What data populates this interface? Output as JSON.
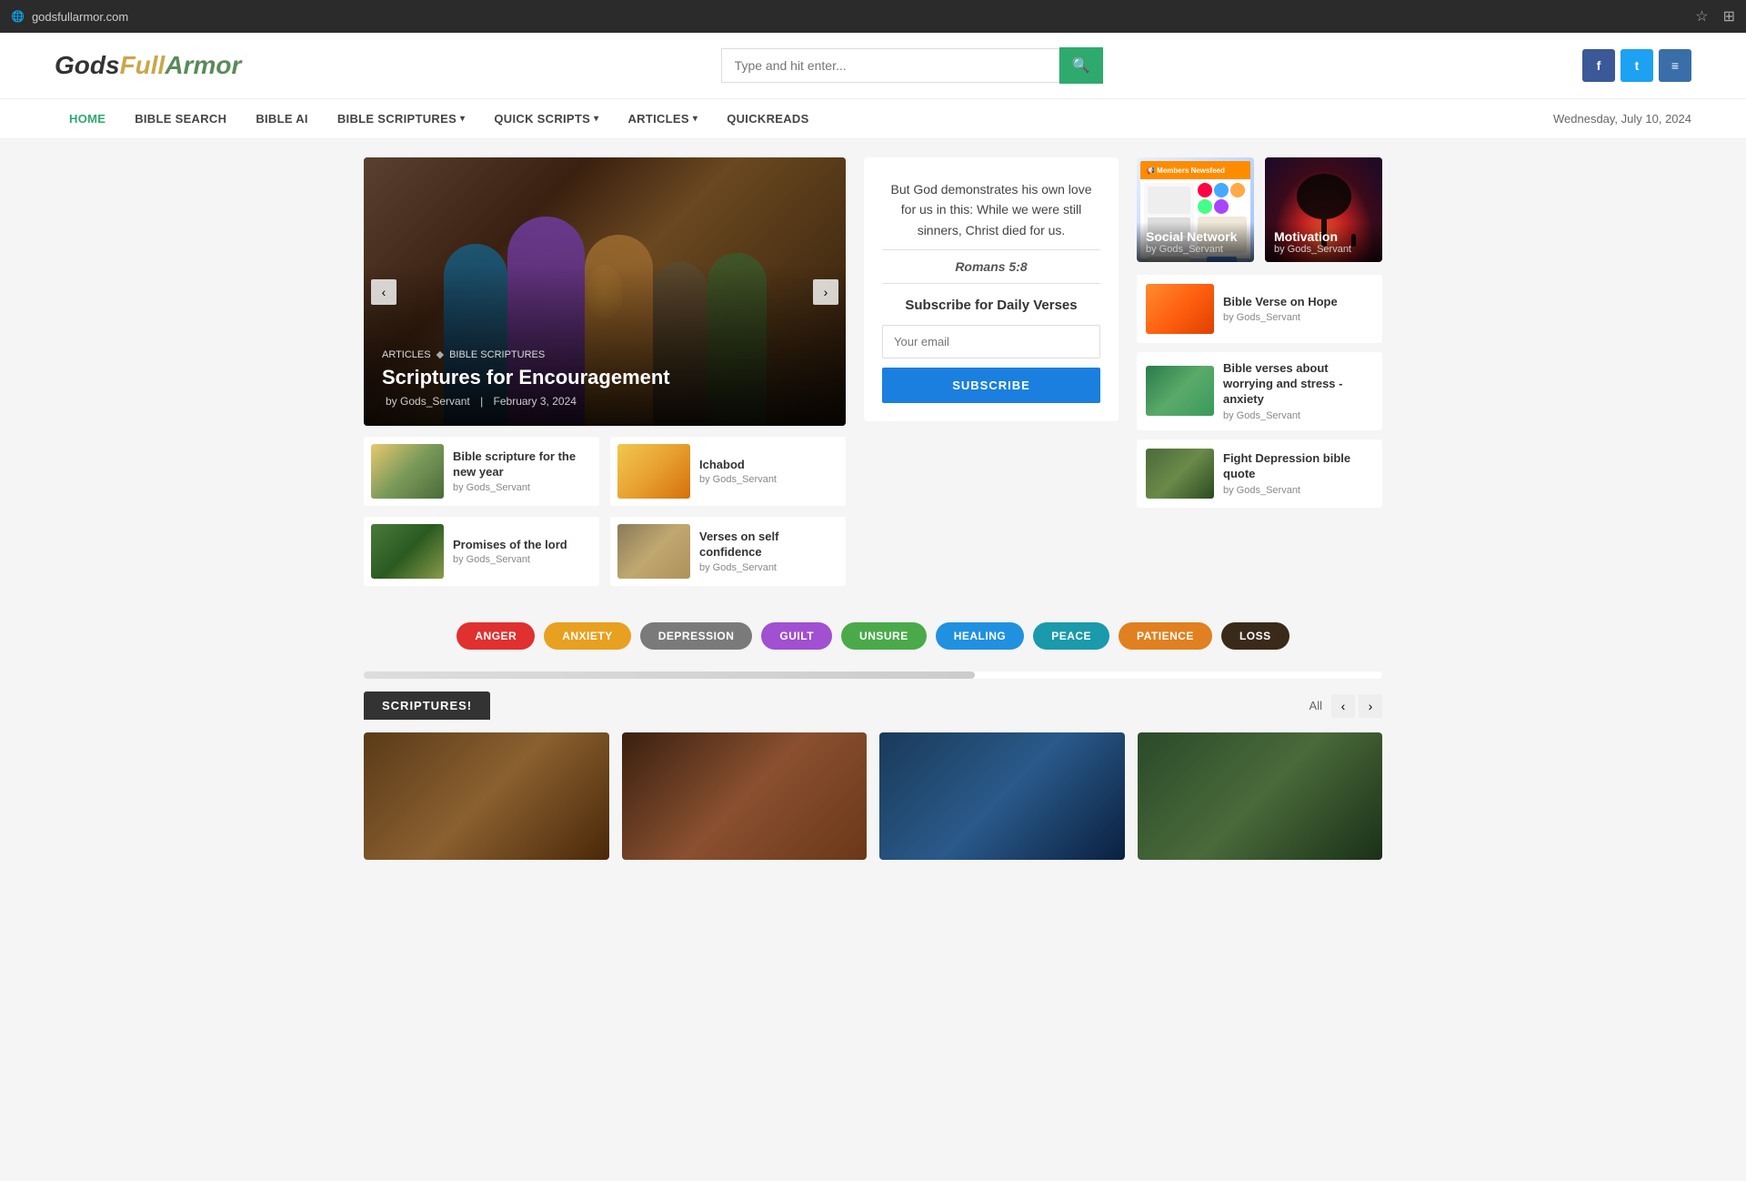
{
  "browser": {
    "url": "godsfullarmor.com",
    "favicon": "🌐"
  },
  "header": {
    "logo": {
      "gods": "Gods",
      "full": "Full",
      "armor": "Armor"
    },
    "search_placeholder": "Type and hit enter...",
    "social": {
      "facebook_label": "f",
      "twitter_label": "t",
      "menu_label": "≡"
    }
  },
  "nav": {
    "items": [
      {
        "label": "HOME",
        "active": true
      },
      {
        "label": "BIBLE SEARCH",
        "active": false
      },
      {
        "label": "BIBLE AI",
        "active": false
      },
      {
        "label": "BIBLE SCRIPTURES",
        "active": false,
        "has_arrow": true
      },
      {
        "label": "QUICK SCRIPTS",
        "active": false,
        "has_arrow": true
      },
      {
        "label": "ARTICLES",
        "active": false,
        "has_arrow": true
      },
      {
        "label": "QUICKREADS",
        "active": false
      }
    ],
    "date": "Wednesday, July 10, 2024"
  },
  "carousel": {
    "breadcrumb_1": "ARTICLES",
    "breadcrumb_2": "BIBLE SCRIPTURES",
    "title": "Scriptures for Encouragement",
    "author": "by Gods_Servant",
    "date": "February 3, 2024",
    "prev_label": "‹",
    "next_label": "›"
  },
  "small_cards": [
    {
      "title": "Bible scripture for the new year",
      "author": "by Gods_Servant",
      "img_class": "img-bible-new"
    },
    {
      "title": "Ichabod",
      "author": "by Gods_Servant",
      "img_class": "img-ichabod"
    },
    {
      "title": "Promises of the lord",
      "author": "by Gods_Servant",
      "img_class": "img-promises"
    },
    {
      "title": "Verses on self confidence",
      "author": "by Gods_Servant",
      "img_class": "img-verses-conf"
    }
  ],
  "verse_box": {
    "text": "But God demonstrates his own love for us in this: While we were still sinners, Christ died for us.",
    "reference": "Romans 5:8"
  },
  "subscribe": {
    "title": "Subscribe for Daily Verses",
    "email_placeholder": "Your email",
    "button_label": "SUBSCRIBE"
  },
  "featured_cards": [
    {
      "title": "Social Network",
      "author": "by Gods_Servant",
      "type": "social"
    },
    {
      "title": "Motivation",
      "author": "by Gods_Servant",
      "type": "motivation"
    }
  ],
  "side_articles": [
    {
      "title": "Bible Verse on Hope",
      "author": "by Gods_Servant",
      "img_class": "img-hope"
    },
    {
      "title": "Bible verses about worrying and stress - anxiety",
      "author": "by Gods_Servant",
      "img_class": "img-worry"
    },
    {
      "title": "Fight Depression bible quote",
      "author": "by Gods_Servant",
      "img_class": "img-depression"
    }
  ],
  "tags": [
    {
      "label": "ANGER",
      "class": "tag-anger"
    },
    {
      "label": "ANXIETY",
      "class": "tag-anxiety"
    },
    {
      "label": "DEPRESSION",
      "class": "tag-depression"
    },
    {
      "label": "GUILT",
      "class": "tag-guilt"
    },
    {
      "label": "UNSURE",
      "class": "tag-unsure"
    },
    {
      "label": "HEALING",
      "class": "tag-healing"
    },
    {
      "label": "PEACE",
      "class": "tag-peace"
    },
    {
      "label": "PATIENCE",
      "class": "tag-patience"
    },
    {
      "label": "LOSS",
      "class": "tag-loss"
    }
  ],
  "scriptures_section": {
    "title": "SCRIPTURES!",
    "all_label": "All",
    "prev_label": "‹",
    "next_label": "›"
  },
  "bottom_cards": [
    {
      "img_class": "img-bottom-1"
    },
    {
      "img_class": "img-bottom-2"
    },
    {
      "img_class": "img-bottom-3"
    },
    {
      "img_class": "img-bottom-4"
    }
  ]
}
